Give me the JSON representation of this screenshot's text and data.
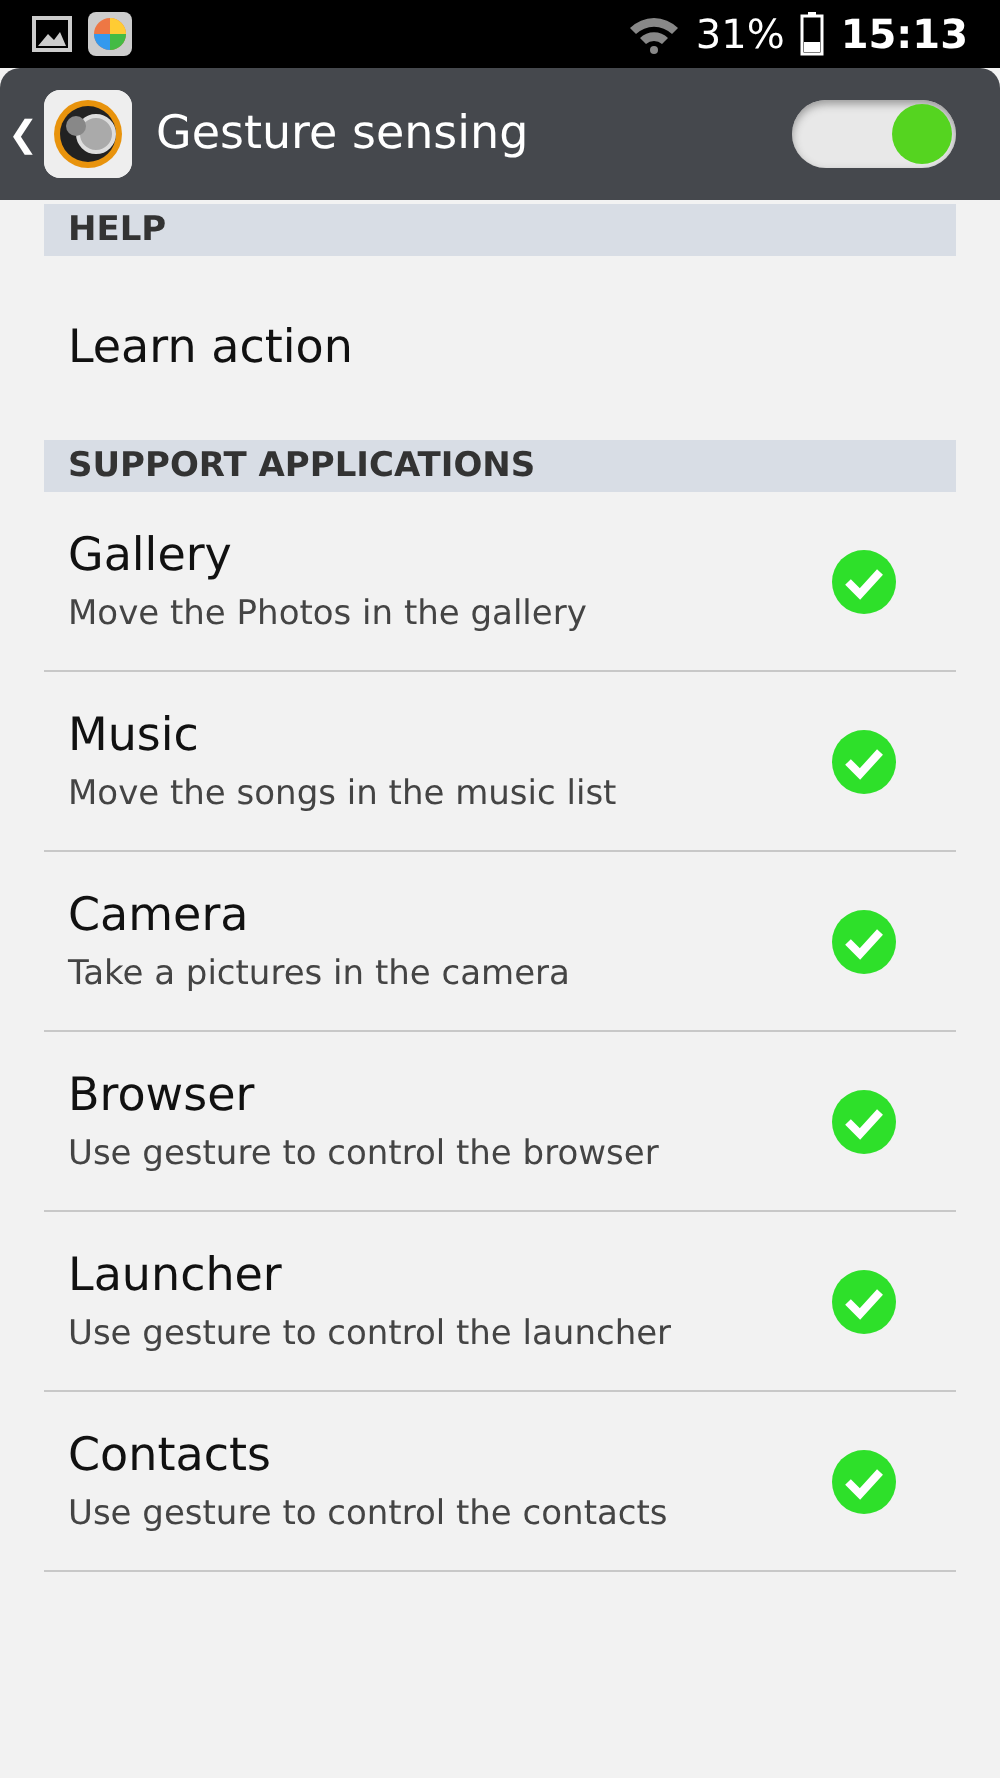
{
  "status_bar": {
    "battery": "31%",
    "time": "15:13"
  },
  "header": {
    "title": "Gesture sensing",
    "back": "❮",
    "on": true
  },
  "sections": [
    {
      "title": "HELP",
      "items": [
        {
          "kind": "action",
          "title": "Learn action"
        }
      ]
    },
    {
      "title": "SUPPORT APPLICATIONS",
      "items": [
        {
          "kind": "check",
          "title": "Gallery",
          "subtitle": "Move the Photos in the gallery",
          "checked": true
        },
        {
          "kind": "check",
          "title": "Music",
          "subtitle": "Move the songs in the music list",
          "checked": true
        },
        {
          "kind": "check",
          "title": "Camera",
          "subtitle": "Take a pictures in the camera",
          "checked": true
        },
        {
          "kind": "check",
          "title": "Browser",
          "subtitle": "Use gesture to control the browser",
          "checked": true
        },
        {
          "kind": "check",
          "title": "Launcher",
          "subtitle": "Use gesture to control the launcher",
          "checked": true
        },
        {
          "kind": "check",
          "title": "Contacts",
          "subtitle": "Use gesture to control the contacts",
          "checked": true
        }
      ]
    }
  ]
}
